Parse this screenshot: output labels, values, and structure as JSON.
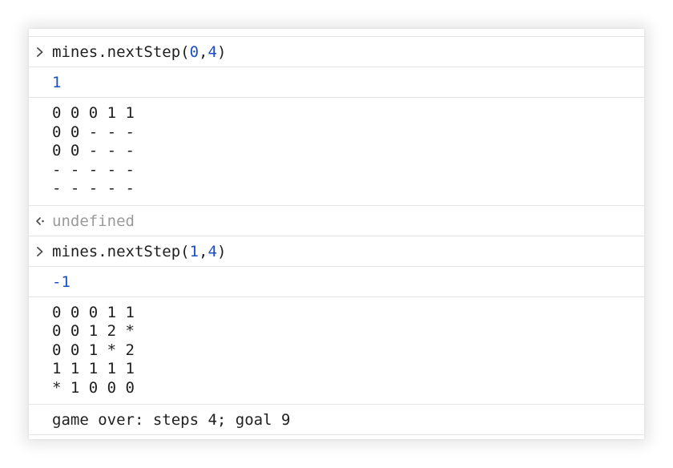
{
  "console": {
    "entries": [
      {
        "input": {
          "prefix_icon": "chevron-right-icon",
          "fn": "mines.nextStep(",
          "arg1": "0",
          "comma": ",",
          "arg2": "4",
          "close": ")"
        },
        "log_value": "1",
        "grid": [
          "0 0 0 1 1",
          "0 0 - - -",
          "0 0 - - -",
          "- - - - -",
          "- - - - -"
        ],
        "return": {
          "prefix_icon": "return-arrow-icon",
          "value": "undefined"
        }
      },
      {
        "input": {
          "prefix_icon": "chevron-right-icon",
          "fn": "mines.nextStep(",
          "arg1": "1",
          "comma": ",",
          "arg2": "4",
          "close": ")"
        },
        "log_value": "-1",
        "grid": [
          "0 0 0 1 1",
          "0 0 1 2 *",
          "0 0 1 * 2",
          "1 1 1 1 1",
          "* 1 0 0 0"
        ],
        "message": "game over: steps 4; goal 9"
      }
    ]
  },
  "colors": {
    "number": "#1a4fc4",
    "muted": "#9a9a9a",
    "text": "#1f1f1f",
    "separator": "#e4e4e4"
  }
}
